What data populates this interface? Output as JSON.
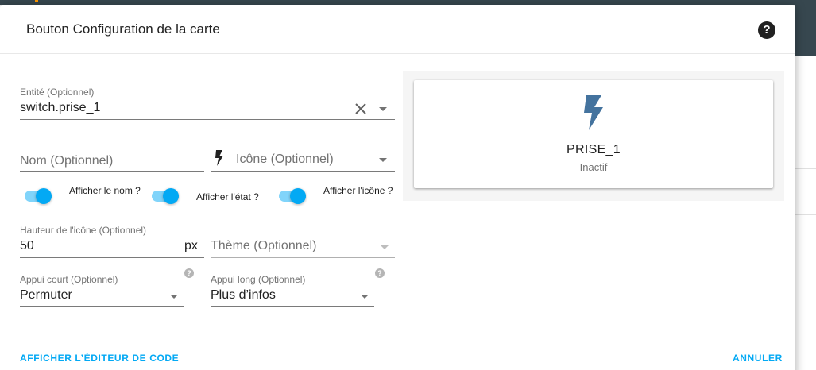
{
  "dialog": {
    "title": "Bouton Configuration de la carte",
    "help_label": "?"
  },
  "form": {
    "entity": {
      "label": "Entité (Optionnel)",
      "value": "switch.prise_1"
    },
    "name": {
      "placeholder": "Nom (Optionnel)"
    },
    "icon": {
      "placeholder": "Icône (Optionnel)"
    },
    "toggles": [
      {
        "label": "Afficher le nom ?",
        "checked": true
      },
      {
        "label": "Afficher l'état ?",
        "checked": true
      },
      {
        "label": "Afficher l'icône ?",
        "checked": true
      }
    ],
    "icon_height": {
      "label": "Hauteur de l'icône (Optionnel)",
      "value": "50",
      "suffix": "px"
    },
    "theme": {
      "placeholder": "Thème (Optionnel)"
    },
    "tap_action": {
      "label": "Appui court (Optionnel)",
      "value": "Permuter",
      "hint": "?"
    },
    "hold_action": {
      "label": "Appui long (Optionnel)",
      "value": "Plus d’infos",
      "hint": "?"
    }
  },
  "preview": {
    "name": "PRISE_1",
    "state": "Inactif",
    "icon": "flash-icon",
    "icon_color": "#44739e"
  },
  "footer": {
    "code_editor_label": "AFFICHER L’ÉDITEUR DE CODE",
    "cancel_label": "ANNULER"
  },
  "colors": {
    "accent": "#03a9f4",
    "toggle_track": "#81d4fa",
    "app_header": "#37474f"
  }
}
